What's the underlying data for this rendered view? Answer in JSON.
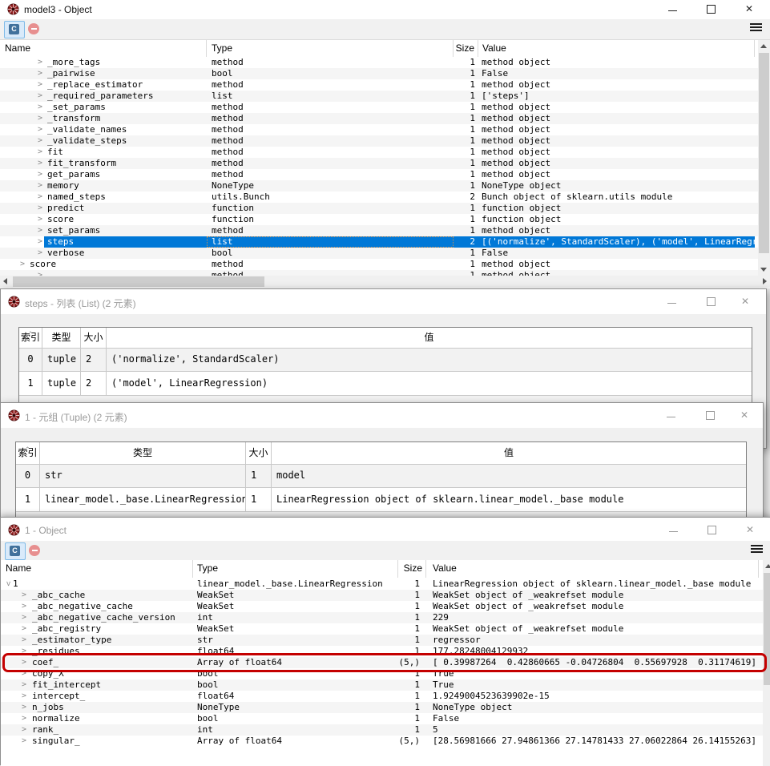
{
  "windows": {
    "win1": {
      "title": "model3 - Object",
      "toolbar": {
        "callable_label": "C"
      },
      "columns": {
        "name": "Name",
        "type": "Type",
        "size": "Size",
        "value": "Value"
      },
      "rows": [
        {
          "depth": "d2",
          "name": "_more_tags",
          "type": "method",
          "size": "1",
          "value": "method object"
        },
        {
          "depth": "d2",
          "name": "_pairwise",
          "type": "bool",
          "size": "1",
          "value": "False"
        },
        {
          "depth": "d2",
          "name": "_replace_estimator",
          "type": "method",
          "size": "1",
          "value": "method object"
        },
        {
          "depth": "d2",
          "name": "_required_parameters",
          "type": "list",
          "size": "1",
          "value": "['steps']"
        },
        {
          "depth": "d2",
          "name": "_set_params",
          "type": "method",
          "size": "1",
          "value": "method object"
        },
        {
          "depth": "d2",
          "name": "_transform",
          "type": "method",
          "size": "1",
          "value": "method object"
        },
        {
          "depth": "d2",
          "name": "_validate_names",
          "type": "method",
          "size": "1",
          "value": "method object"
        },
        {
          "depth": "d2",
          "name": "_validate_steps",
          "type": "method",
          "size": "1",
          "value": "method object"
        },
        {
          "depth": "d2",
          "name": "fit",
          "type": "method",
          "size": "1",
          "value": "method object"
        },
        {
          "depth": "d2",
          "name": "fit_transform",
          "type": "method",
          "size": "1",
          "value": "method object"
        },
        {
          "depth": "d2",
          "name": "get_params",
          "type": "method",
          "size": "1",
          "value": "method object"
        },
        {
          "depth": "d2",
          "name": "memory",
          "type": "NoneType",
          "size": "1",
          "value": "NoneType object"
        },
        {
          "depth": "d2",
          "name": "named_steps",
          "type": "utils.Bunch",
          "size": "2",
          "value": "Bunch object of sklearn.utils module"
        },
        {
          "depth": "d2",
          "name": "predict",
          "type": "function",
          "size": "1",
          "value": "function object"
        },
        {
          "depth": "d2",
          "name": "score",
          "type": "function",
          "size": "1",
          "value": "function object"
        },
        {
          "depth": "d2",
          "name": "set_params",
          "type": "method",
          "size": "1",
          "value": "method object"
        },
        {
          "depth": "d2",
          "name": "steps",
          "type": "list",
          "size": "2",
          "value": "[('normalize', StandardScaler), ('model', LinearRegression)]",
          "selected": true
        },
        {
          "depth": "d2",
          "name": "verbose",
          "type": "bool",
          "size": "1",
          "value": "False"
        },
        {
          "depth": "d1",
          "name": "score",
          "type": "method",
          "size": "1",
          "value": "method object"
        },
        {
          "depth": "d2",
          "name": "",
          "type": "method",
          "size": "1",
          "value": "method object"
        }
      ]
    },
    "win2": {
      "title": "steps - 列表 (List) (2 元素)",
      "columns": {
        "index": "索引",
        "type": "类型",
        "size": "大小",
        "value": "值"
      },
      "rows": [
        {
          "index": "0",
          "type": "tuple",
          "size": "2",
          "value": "('normalize', StandardScaler)"
        },
        {
          "index": "1",
          "type": "tuple",
          "size": "2",
          "value": "('model', LinearRegression)"
        }
      ]
    },
    "win3": {
      "title": "1 - 元组 (Tuple) (2 元素)",
      "columns": {
        "index": "索引",
        "type": "类型",
        "size": "大小",
        "value": "值"
      },
      "rows": [
        {
          "index": "0",
          "type": "str",
          "size": "1",
          "value": "model"
        },
        {
          "index": "1",
          "type": "linear_model._base.LinearRegression",
          "size": "1",
          "value": "LinearRegression object of sklearn.linear_model._base module"
        }
      ]
    },
    "win4": {
      "title": "1 - Object",
      "toolbar": {
        "callable_label": "C"
      },
      "columns": {
        "name": "Name",
        "type": "Type",
        "size": "Size",
        "value": "Value"
      },
      "rows": [
        {
          "depth": "d0",
          "name": "1",
          "type": "linear_model._base.LinearRegression",
          "size": "1",
          "value": "LinearRegression object of sklearn.linear_model._base module",
          "expanded": true
        },
        {
          "depth": "d1",
          "name": "_abc_cache",
          "type": "WeakSet",
          "size": "1",
          "value": "WeakSet object of _weakrefset module"
        },
        {
          "depth": "d1",
          "name": "_abc_negative_cache",
          "type": "WeakSet",
          "size": "1",
          "value": "WeakSet object of _weakrefset module"
        },
        {
          "depth": "d1",
          "name": "_abc_negative_cache_version",
          "type": "int",
          "size": "1",
          "value": "229"
        },
        {
          "depth": "d1",
          "name": "_abc_registry",
          "type": "WeakSet",
          "size": "1",
          "value": "WeakSet object of _weakrefset module"
        },
        {
          "depth": "d1",
          "name": "_estimator_type",
          "type": "str",
          "size": "1",
          "value": "regressor"
        },
        {
          "depth": "d1",
          "name": "_residues",
          "type": "float64",
          "size": "1",
          "value": "177.28248004129932"
        },
        {
          "depth": "d1",
          "name": "coef_",
          "type": "Array of float64",
          "size": "(5,)",
          "value": "[ 0.39987264  0.42860665 -0.04726804  0.55697928  0.31174619]",
          "annotated": true
        },
        {
          "depth": "d1",
          "name": "copy_X",
          "type": "bool",
          "size": "1",
          "value": "True"
        },
        {
          "depth": "d1",
          "name": "fit_intercept",
          "type": "bool",
          "size": "1",
          "value": "True"
        },
        {
          "depth": "d1",
          "name": "intercept_",
          "type": "float64",
          "size": "1",
          "value": "1.9249004523639902e-15"
        },
        {
          "depth": "d1",
          "name": "n_jobs",
          "type": "NoneType",
          "size": "1",
          "value": "NoneType object"
        },
        {
          "depth": "d1",
          "name": "normalize",
          "type": "bool",
          "size": "1",
          "value": "False"
        },
        {
          "depth": "d1",
          "name": "rank_",
          "type": "int",
          "size": "1",
          "value": "5"
        },
        {
          "depth": "d1",
          "name": "singular_",
          "type": "Array of float64",
          "size": "(5,)",
          "value": "[28.56981666 27.94861366 27.14781433 27.06022864 26.14155263]"
        }
      ]
    }
  }
}
